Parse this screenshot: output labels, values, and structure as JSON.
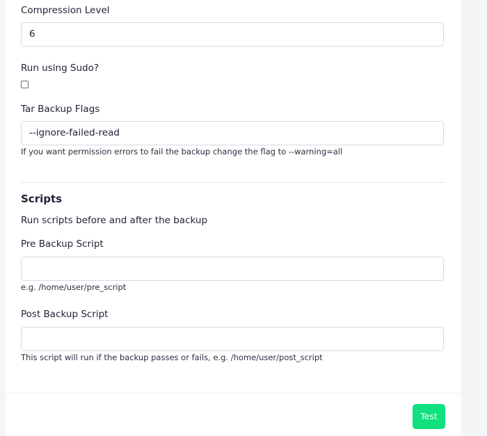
{
  "form": {
    "compression": {
      "label": "Compression Level",
      "value": "6"
    },
    "sudo": {
      "label": "Run using Sudo?",
      "checked": false
    },
    "tar_flags": {
      "label": "Tar Backup Flags",
      "value": "--ignore-failed-read",
      "hint": "If you want permission errors to fail the backup change the flag to --warning=all"
    }
  },
  "scripts": {
    "title": "Scripts",
    "description": "Run scripts before and after the backup",
    "pre": {
      "label": "Pre Backup Script",
      "value": "",
      "hint": "e.g. /home/user/pre_script"
    },
    "post": {
      "label": "Post Backup Script",
      "value": "",
      "hint": "This script will run if the backup passes or fails, e.g. /home/user/post_script"
    }
  },
  "footer": {
    "test_label": "Test",
    "button_color": "#10e07e"
  }
}
